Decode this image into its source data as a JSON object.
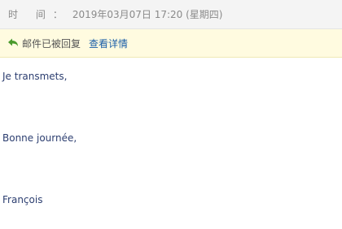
{
  "header": {
    "time_label": "时  间：",
    "time_value": "2019年03月07日 17:20 (星期四)"
  },
  "reply_bar": {
    "status_text": "邮件已被回复",
    "details_link": "查看详情",
    "icon": "reply-arrow-icon",
    "icon_color": "#4a9a2c"
  },
  "message": {
    "lines": [
      "Je transmets,",
      "Bonne journée,",
      "François"
    ]
  },
  "colors": {
    "body_text": "#2c3e70",
    "link": "#1a5ea8",
    "reply_bar_bg": "#fffbe0",
    "header_bg": "#f4f4f4"
  }
}
